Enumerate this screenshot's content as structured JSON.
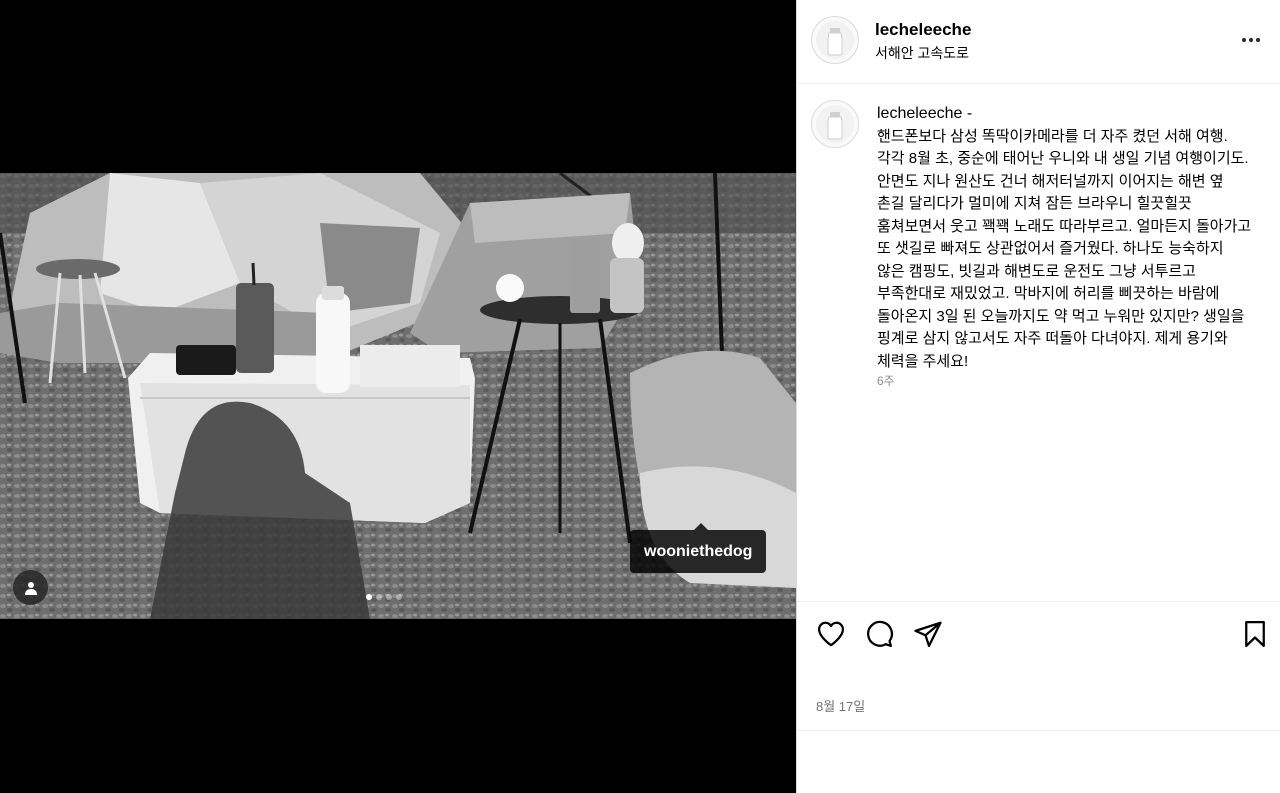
{
  "post": {
    "username": "lecheleeche",
    "location": "서해안 고속도로",
    "caption_author": "lecheleeche -",
    "caption": "핸드폰보다 삼성 똑딱이카메라를 더 자주 켰던 서해 여행. 각각 8월 초, 중순에 태어난 우니와 내 생일 기념 여행이기도. 안면도 지나 원산도 건너 해저터널까지 이어지는 해변 옆 촌길 달리다가 멀미에 지쳐 잠든 브라우니 힐끗힐끗 훔쳐보면서 웃고 꽥꽥 노래도 따라부르고. 얼마든지 돌아가고 또 샛길로 빠져도 상관없어서 즐거웠다. 하나도 능숙하지 않은 캠핑도, 빗길과 해변도로 운전도 그냥 서투르고 부족한대로 재밌었고. 막바지에 허리를 삐끗하는 바람에 돌아온지 3일 된 오늘까지도 약 먹고 누워만 있지만? 생일을 핑계로 삼지 않고서도 자주 떠돌아 다녀야지. 제게 용기와 체력을 주세요!",
    "caption_age": "6주",
    "date": "8월 17일",
    "tag": "wooniethedog",
    "carousel": {
      "count": 4,
      "current": 1
    }
  },
  "icons": {
    "more": "more-horizontal-icon",
    "like": "heart-icon",
    "comment": "comment-icon",
    "share": "paper-plane-icon",
    "save": "bookmark-icon",
    "user_tags": "user-icon"
  }
}
